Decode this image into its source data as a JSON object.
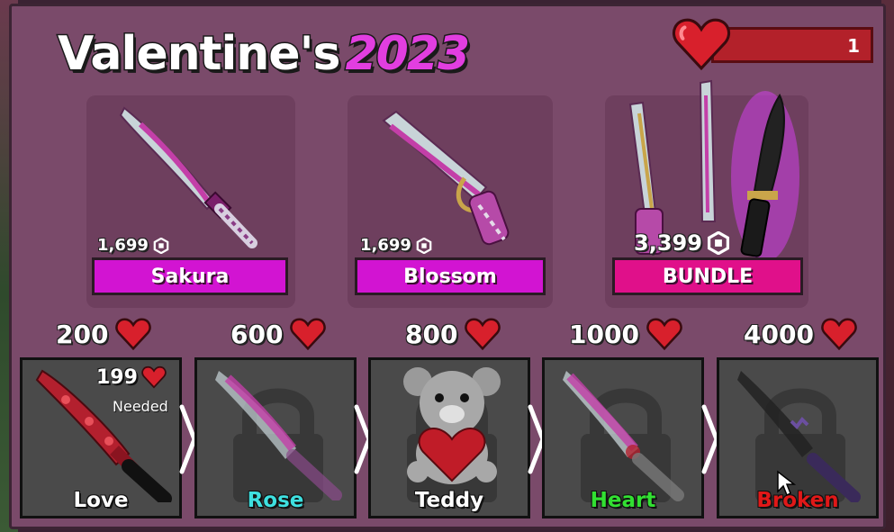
{
  "header": {
    "title_main": "Valentine's",
    "title_year": "2023",
    "hearts_count": "1",
    "hearts_icon": "heart-icon"
  },
  "shop": {
    "items": [
      {
        "name": "Sakura",
        "price": "1,699",
        "currency_icon": "robux-icon",
        "label_color": "#d214d2"
      },
      {
        "name": "Blossom",
        "price": "1,699",
        "currency_icon": "robux-icon",
        "label_color": "#d214d2"
      },
      {
        "name": "BUNDLE",
        "price": "3,399",
        "currency_icon": "robux-icon",
        "label_color": "#e0108a"
      }
    ]
  },
  "tiers": [
    {
      "cost": "200",
      "name": "Love",
      "name_color": "#ffffff",
      "unlocked": true,
      "needed_count": "199",
      "needed_label": "Needed"
    },
    {
      "cost": "600",
      "name": "Rose",
      "name_color": "#3ee0e0",
      "unlocked": false
    },
    {
      "cost": "800",
      "name": "Teddy",
      "name_color": "#ffffff",
      "unlocked": false
    },
    {
      "cost": "1000",
      "name": "Heart",
      "name_color": "#32e032",
      "unlocked": false
    },
    {
      "cost": "4000",
      "name": "Broken",
      "name_color": "#e01818",
      "unlocked": false
    }
  ],
  "colors": {
    "panel": "#7a4a6a",
    "heart": "#d8202c",
    "accent_pink": "#e23ee0"
  }
}
